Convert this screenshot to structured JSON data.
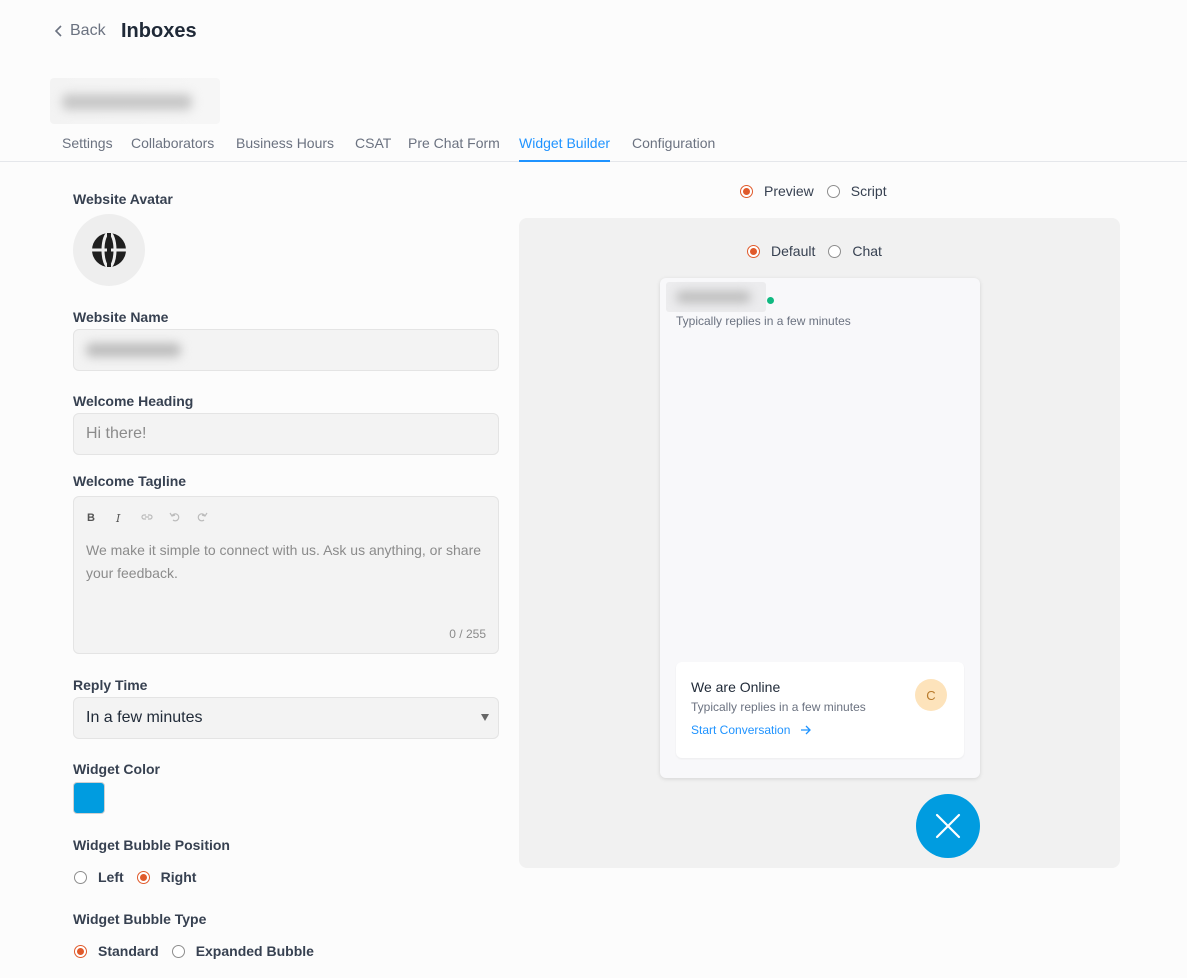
{
  "header": {
    "back_label": "Back",
    "title": "Inboxes"
  },
  "tabs": [
    {
      "label": "Settings"
    },
    {
      "label": "Collaborators"
    },
    {
      "label": "Business Hours"
    },
    {
      "label": "CSAT"
    },
    {
      "label": "Pre Chat Form"
    },
    {
      "label": "Widget Builder",
      "active": true
    },
    {
      "label": "Configuration"
    }
  ],
  "form": {
    "avatar_label": "Website Avatar",
    "avatar_icon": "globe-icon",
    "name_label": "Website Name",
    "heading_label": "Welcome Heading",
    "heading_placeholder": "Hi there!",
    "tagline_label": "Welcome Tagline",
    "tagline_placeholder": "We make it simple to connect with us. Ask us anything, or share your feedback.",
    "tagline_counter": "0 / 255",
    "toolbar": {
      "bold": "B",
      "italic": "I"
    },
    "reply_time_label": "Reply Time",
    "reply_time_value": "In a few minutes",
    "color_label": "Widget Color",
    "color_value": "#009ce0",
    "bubble_position_label": "Widget Bubble Position",
    "bubble_position_options": [
      "Left",
      "Right"
    ],
    "bubble_position_selected": "Right",
    "bubble_type_label": "Widget Bubble Type",
    "bubble_type_options": [
      "Standard",
      "Expanded Bubble"
    ],
    "bubble_type_selected": "Standard"
  },
  "preview": {
    "mode_options": [
      "Preview",
      "Script"
    ],
    "mode_selected": "Preview",
    "view_options": [
      "Default",
      "Chat"
    ],
    "view_selected": "Default",
    "widget_subtitle": "Typically replies in a few minutes",
    "card_title": "We are Online",
    "card_subtitle": "Typically replies in a few minutes",
    "card_link": "Start Conversation",
    "agent_initial": "C"
  },
  "colors": {
    "accent": "#1f93ff",
    "radio": "#e05a2b",
    "widget": "#009ce0"
  }
}
